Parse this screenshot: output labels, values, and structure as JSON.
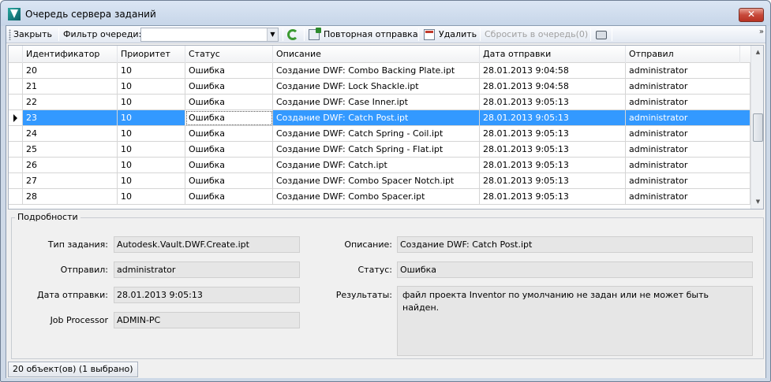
{
  "window": {
    "title": "Очередь сервера заданий",
    "close_label": "✕"
  },
  "toolbar": {
    "close_label": "Закрыть",
    "filter_label": "Фильтр очереди:",
    "filter_value": "",
    "resend_label": "Повторная отправка",
    "delete_label": "Удалить",
    "reset_label": "Сбросить в очередь(0)",
    "overflow_label": "»"
  },
  "grid": {
    "columns": [
      "Идентификатор",
      "Приоритет",
      "Статус",
      "Описание",
      "Дата отправки",
      "Отправил"
    ],
    "rows": [
      {
        "id": "20",
        "priority": "10",
        "status": "Ошибка",
        "description": "Создание DWF: Combo Backing Plate.ipt",
        "date": "28.01.2013 9:04:58",
        "user": "administrator"
      },
      {
        "id": "21",
        "priority": "10",
        "status": "Ошибка",
        "description": "Создание DWF: Lock Shackle.ipt",
        "date": "28.01.2013 9:04:58",
        "user": "administrator"
      },
      {
        "id": "22",
        "priority": "10",
        "status": "Ошибка",
        "description": "Создание DWF: Case Inner.ipt",
        "date": "28.01.2013 9:05:13",
        "user": "administrator"
      },
      {
        "id": "23",
        "priority": "10",
        "status": "Ошибка",
        "description": "Создание DWF: Catch Post.ipt",
        "date": "28.01.2013 9:05:13",
        "user": "administrator"
      },
      {
        "id": "24",
        "priority": "10",
        "status": "Ошибка",
        "description": "Создание DWF: Catch Spring - Coil.ipt",
        "date": "28.01.2013 9:05:13",
        "user": "administrator"
      },
      {
        "id": "25",
        "priority": "10",
        "status": "Ошибка",
        "description": "Создание DWF: Catch Spring - Flat.ipt",
        "date": "28.01.2013 9:05:13",
        "user": "administrator"
      },
      {
        "id": "26",
        "priority": "10",
        "status": "Ошибка",
        "description": "Создание DWF: Catch.ipt",
        "date": "28.01.2013 9:05:13",
        "user": "administrator"
      },
      {
        "id": "27",
        "priority": "10",
        "status": "Ошибка",
        "description": "Создание DWF: Combo Spacer Notch.ipt",
        "date": "28.01.2013 9:05:13",
        "user": "administrator"
      },
      {
        "id": "28",
        "priority": "10",
        "status": "Ошибка",
        "description": "Создание DWF: Combo Spacer.ipt",
        "date": "28.01.2013 9:05:13",
        "user": "administrator"
      }
    ],
    "selected_row": 3
  },
  "details": {
    "legend": "Подробности",
    "job_type_label": "Тип задания:",
    "job_type_value": "Autodesk.Vault.DWF.Create.ipt",
    "sent_by_label": "Отправил:",
    "sent_by_value": "administrator",
    "date_label": "Дата отправки:",
    "date_value": "28.01.2013 9:05:13",
    "processor_label": "Job Processor",
    "processor_value": "ADMIN-PC",
    "description_label": "Описание:",
    "description_value": "Создание DWF: Catch Post.ipt",
    "status_label": "Статус:",
    "status_value": "Ошибка",
    "results_label": "Результаты:",
    "results_value": "файл проекта Inventor по умолчанию не задан или не может быть найден."
  },
  "statusbar": {
    "count_text": "20 объект(ов) (1 выбрано)"
  },
  "colors": {
    "selection": "#3399ff",
    "chrome": "#ced9e7"
  }
}
